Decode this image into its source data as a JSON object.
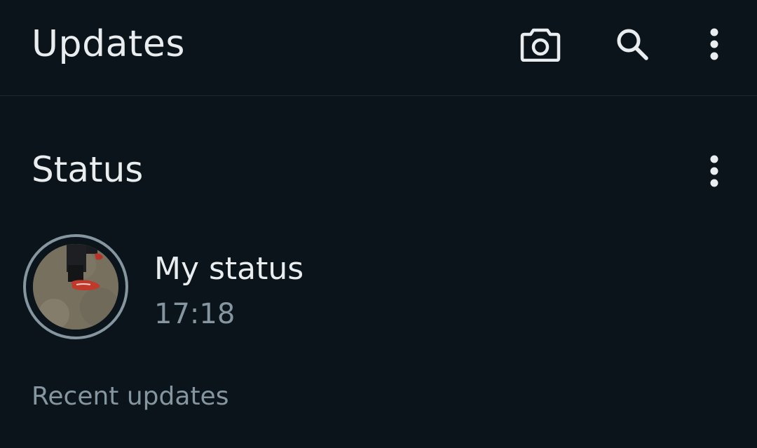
{
  "header": {
    "title": "Updates",
    "icons": [
      "camera-icon",
      "search-icon",
      "more-vert-icon"
    ]
  },
  "status_section": {
    "title": "Status",
    "menu_icon": "more-vert-icon",
    "my_status": {
      "name": "My status",
      "time": "17:18"
    }
  },
  "recent": {
    "label": "Recent updates"
  },
  "colors": {
    "background": "#0b141a",
    "primary_text": "#e9edef",
    "secondary_text": "#8696a0",
    "divider": "#1f2a30",
    "ring": "#8696a0"
  }
}
